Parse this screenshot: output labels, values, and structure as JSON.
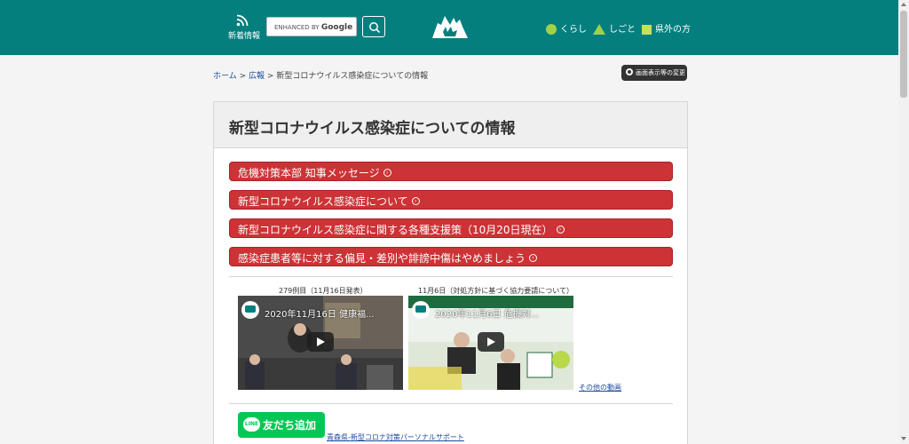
{
  "header": {
    "rss_label": "新着情報",
    "search_brand": "ENHANCED BY",
    "search_google": "Google",
    "nav": [
      {
        "label": "くらし",
        "icon": "circle-icon"
      },
      {
        "label": "しごと",
        "icon": "triangle-icon"
      },
      {
        "label": "県外の方",
        "icon": "square-icon"
      }
    ],
    "colors": {
      "header": "#047f7e",
      "accent_green": "#9fd14a",
      "red_button": "#cc3336"
    }
  },
  "breadcrumb": {
    "home": "ホーム",
    "sep1": ">",
    "section": "広報",
    "sep2": ">",
    "current": "新型コロナウイルス感染症についての情報"
  },
  "display_settings_label": "画面表示等の変更",
  "main": {
    "title": "新型コロナウイルス感染症についての情報",
    "buttons": [
      {
        "label": "危機対策本部 知事メッセージ"
      },
      {
        "label": "新型コロナウイルス感染症について"
      },
      {
        "label": "新型コロナウイルス感染症に関する各種支援策（10月20日現在）"
      },
      {
        "label": "感染症患者等に対する偏見・差別や誹謗中傷はやめましょう"
      }
    ],
    "videos": [
      {
        "caption": "279例目（11月16日発表）",
        "title": "2020年11月16日 健康福..."
      },
      {
        "caption": "11月6日（対処方針に基づく協力要請について）",
        "title": "2020年11月6日 危機対..."
      }
    ],
    "more_videos": "その他の動画",
    "line_button": "友だち追加",
    "line_logo": "LINE",
    "line_caption": "青森県-新型コロナ対策パーソナルサポート"
  }
}
